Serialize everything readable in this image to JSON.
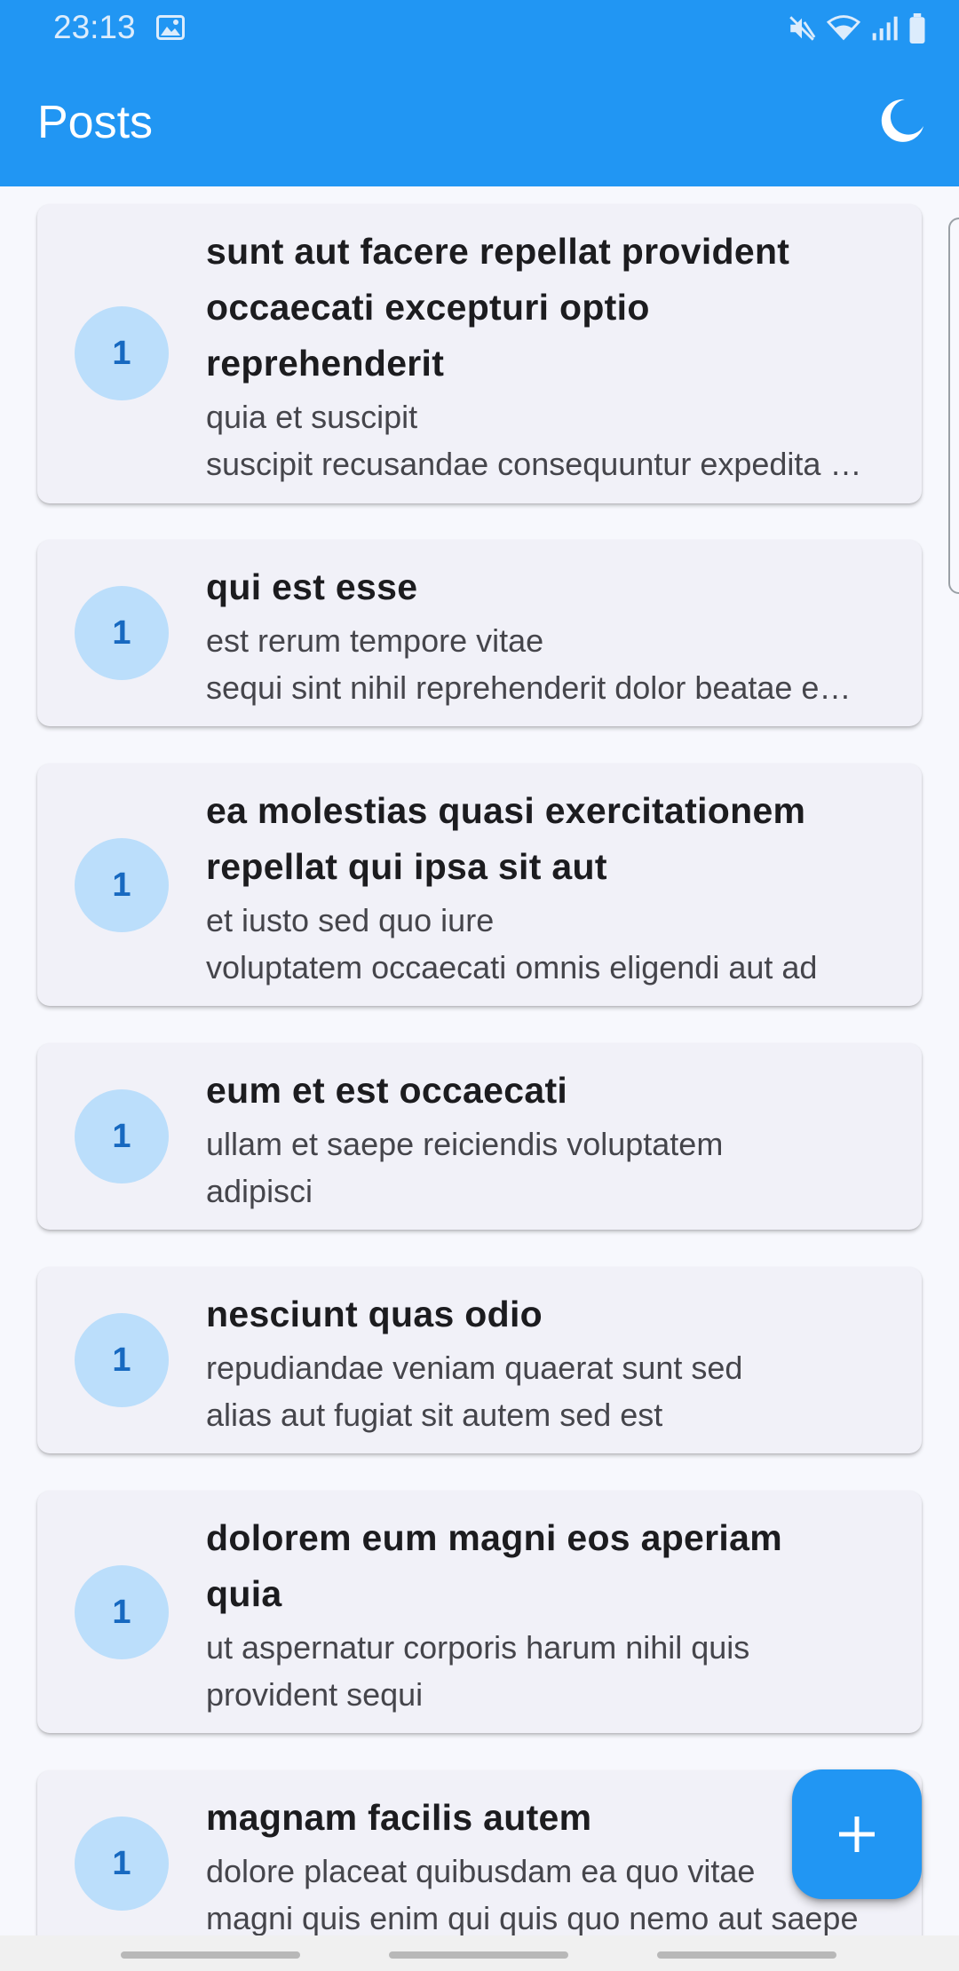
{
  "status_bar": {
    "time": "23:13",
    "icons": [
      "gallery-icon",
      "mute-icon",
      "wifi-icon",
      "signal-icon",
      "battery-icon"
    ]
  },
  "app_bar": {
    "title": "Posts",
    "action_icon": "moon-icon"
  },
  "colors": {
    "primary": "#2196f3",
    "avatar_bg": "#bbdefb",
    "avatar_text": "#1769c0",
    "card_bg": "#f1f1f8"
  },
  "posts": [
    {
      "user_id": "1",
      "title": "sunt aut facere repellat provident occaecati excepturi optio reprehenderit",
      "body_lines": [
        "quia et suscipit",
        "suscipit recusandae consequuntur expedita et cum"
      ]
    },
    {
      "user_id": "1",
      "title": "qui est esse",
      "body_lines": [
        "est rerum tempore vitae",
        "sequi sint nihil reprehenderit dolor beatae ea dolores neque"
      ]
    },
    {
      "user_id": "1",
      "title": "ea molestias quasi exercitationem repellat qui ipsa sit aut",
      "body_lines": [
        "et iusto sed quo iure",
        "voluptatem occaecati omnis eligendi aut ad"
      ]
    },
    {
      "user_id": "1",
      "title": "eum et est occaecati",
      "body_lines": [
        "ullam et saepe reiciendis voluptatem",
        "adipisci"
      ]
    },
    {
      "user_id": "1",
      "title": "nesciunt quas odio",
      "body_lines": [
        "repudiandae veniam quaerat sunt sed",
        "alias aut fugiat sit autem sed est"
      ]
    },
    {
      "user_id": "1",
      "title": "dolorem eum magni eos aperiam quia",
      "body_lines": [
        "ut aspernatur corporis harum nihil quis",
        "provident sequi"
      ]
    },
    {
      "user_id": "1",
      "title": "magnam facilis autem",
      "body_lines": [
        "dolore placeat quibusdam ea quo vitae",
        "magni quis enim qui quis quo nemo aut saepe"
      ]
    }
  ],
  "fab": {
    "icon": "plus-icon"
  }
}
